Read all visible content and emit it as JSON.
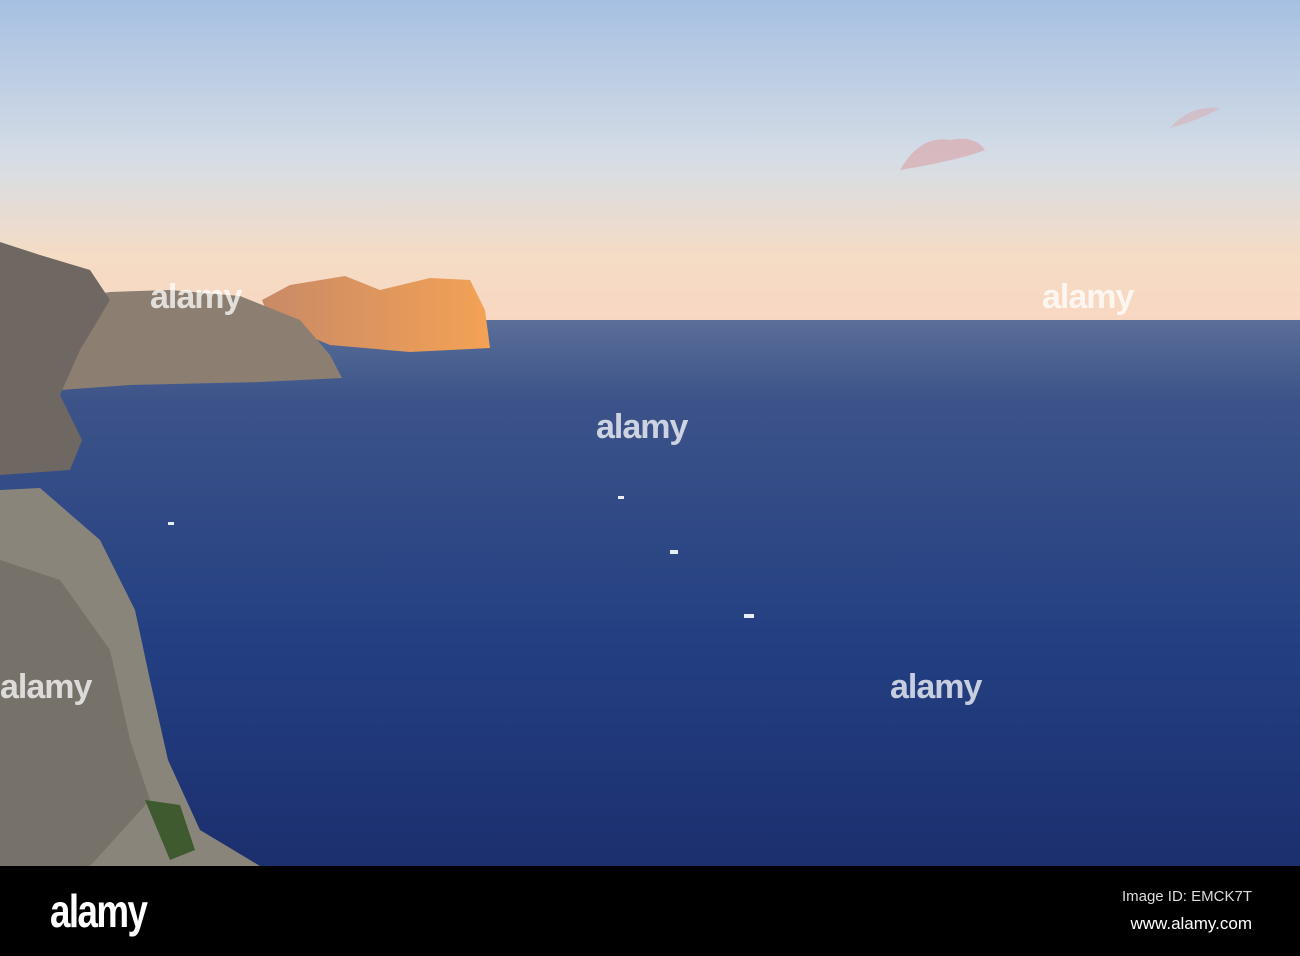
{
  "photo": {
    "subject": "coastal cliffs at sunset over the sea"
  },
  "watermark": {
    "text": "alamy"
  },
  "footer": {
    "logo": "alamy",
    "image_id": "Image ID: EMCK7T",
    "website": "www.alamy.com"
  },
  "colors": {
    "sky_top": "#a9c3e3",
    "sky_horizon": "#f7dcc2",
    "sea": "#253f7d",
    "sunlit_rock": "#f0a060"
  }
}
